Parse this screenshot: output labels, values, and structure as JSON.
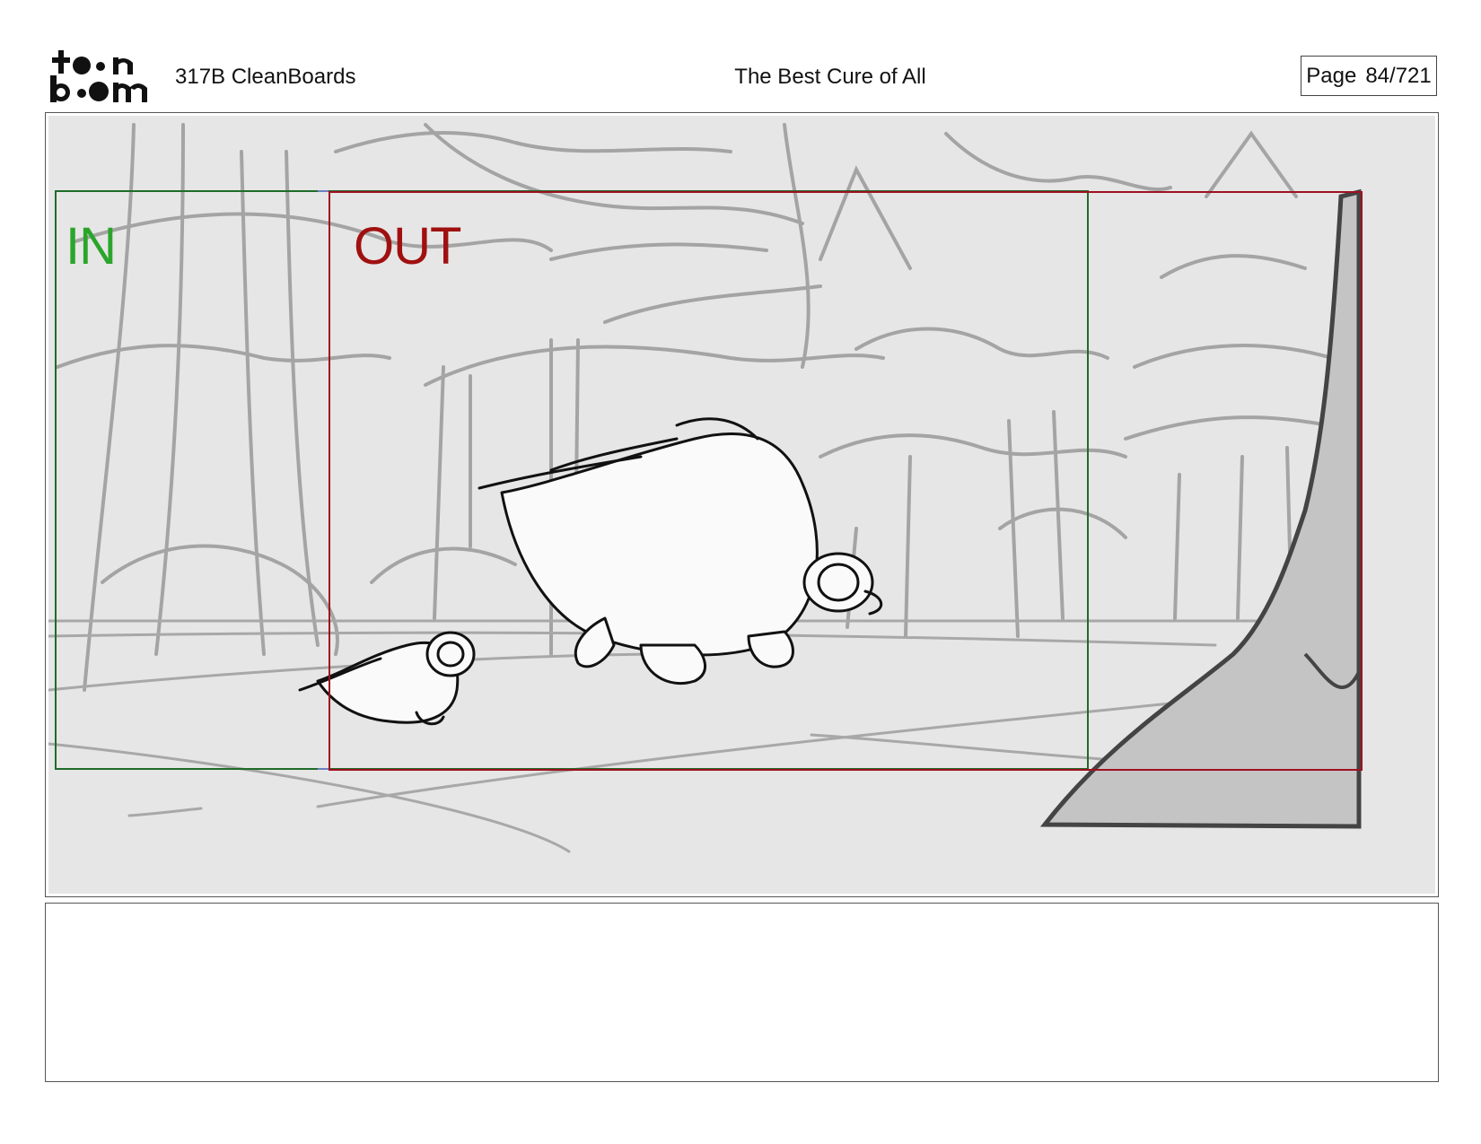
{
  "header": {
    "logo_text": "toonboom",
    "project": "317B  CleanBoards",
    "title": "The Best Cure of All",
    "page_label": "Page",
    "page_number": "84/721"
  },
  "panel": {
    "in_label": "IN",
    "out_label": "OUT"
  },
  "colors": {
    "in_frame": "#1f6b2a",
    "out_frame": "#a01020",
    "in_text": "#2aa52a",
    "out_text": "#a01010",
    "panel_bg": "#e6e6e6",
    "sketch_gray": "#9a9a9a"
  }
}
